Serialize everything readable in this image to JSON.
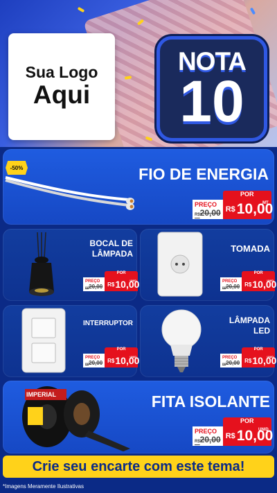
{
  "header": {
    "logo_line1": "Sua Logo",
    "logo_line2": "Aqui",
    "nota_line1": "NOTA",
    "nota_line2": "10"
  },
  "products": [
    {
      "name": "FIO DE ENERGIA",
      "discount": "-50%",
      "por": "POR",
      "preco": "PREÇO",
      "old_prefix": "R$",
      "old_price": "20,00",
      "new_prefix": "R$",
      "new_price": "10,00",
      "unit": "MT"
    },
    {
      "name": "BOCAL DE LÂMPADA",
      "por": "POR",
      "preco": "PREÇO",
      "old_prefix": "R$",
      "old_price": "20,00",
      "new_prefix": "R$",
      "new_price": "10,00",
      "unit": "UNID"
    },
    {
      "name": "TOMADA",
      "por": "POR",
      "preco": "PREÇO",
      "old_prefix": "R$",
      "old_price": "20,00",
      "new_prefix": "R$",
      "new_price": "10,00",
      "unit": "UNID"
    },
    {
      "name": "INTERRUPTOR",
      "por": "POR",
      "preco": "PREÇO",
      "old_prefix": "R$",
      "old_price": "20,00",
      "new_prefix": "R$",
      "new_price": "10,00",
      "unit": "UNID"
    },
    {
      "name": "LÂMPADA LED",
      "por": "POR",
      "preco": "PREÇO",
      "old_prefix": "R$",
      "old_price": "20,00",
      "new_prefix": "R$",
      "new_price": "10,00",
      "unit": "UNID"
    },
    {
      "name": "FITA ISOLANTE",
      "por": "POR",
      "preco": "PREÇO",
      "old_prefix": "R$",
      "old_price": "20,00",
      "new_prefix": "R$",
      "new_price": "10,00",
      "unit": "UNID"
    }
  ],
  "cta": "Crie seu encarte com este tema!",
  "footnote": "*Imagens Meramente Ilustrativas",
  "tape_brand": "IMPERIAL",
  "colors": {
    "background": "#0b2a86",
    "panel": "#1f5ce0",
    "price_red": "#e5111d",
    "cta_yellow": "#ffd21a"
  }
}
